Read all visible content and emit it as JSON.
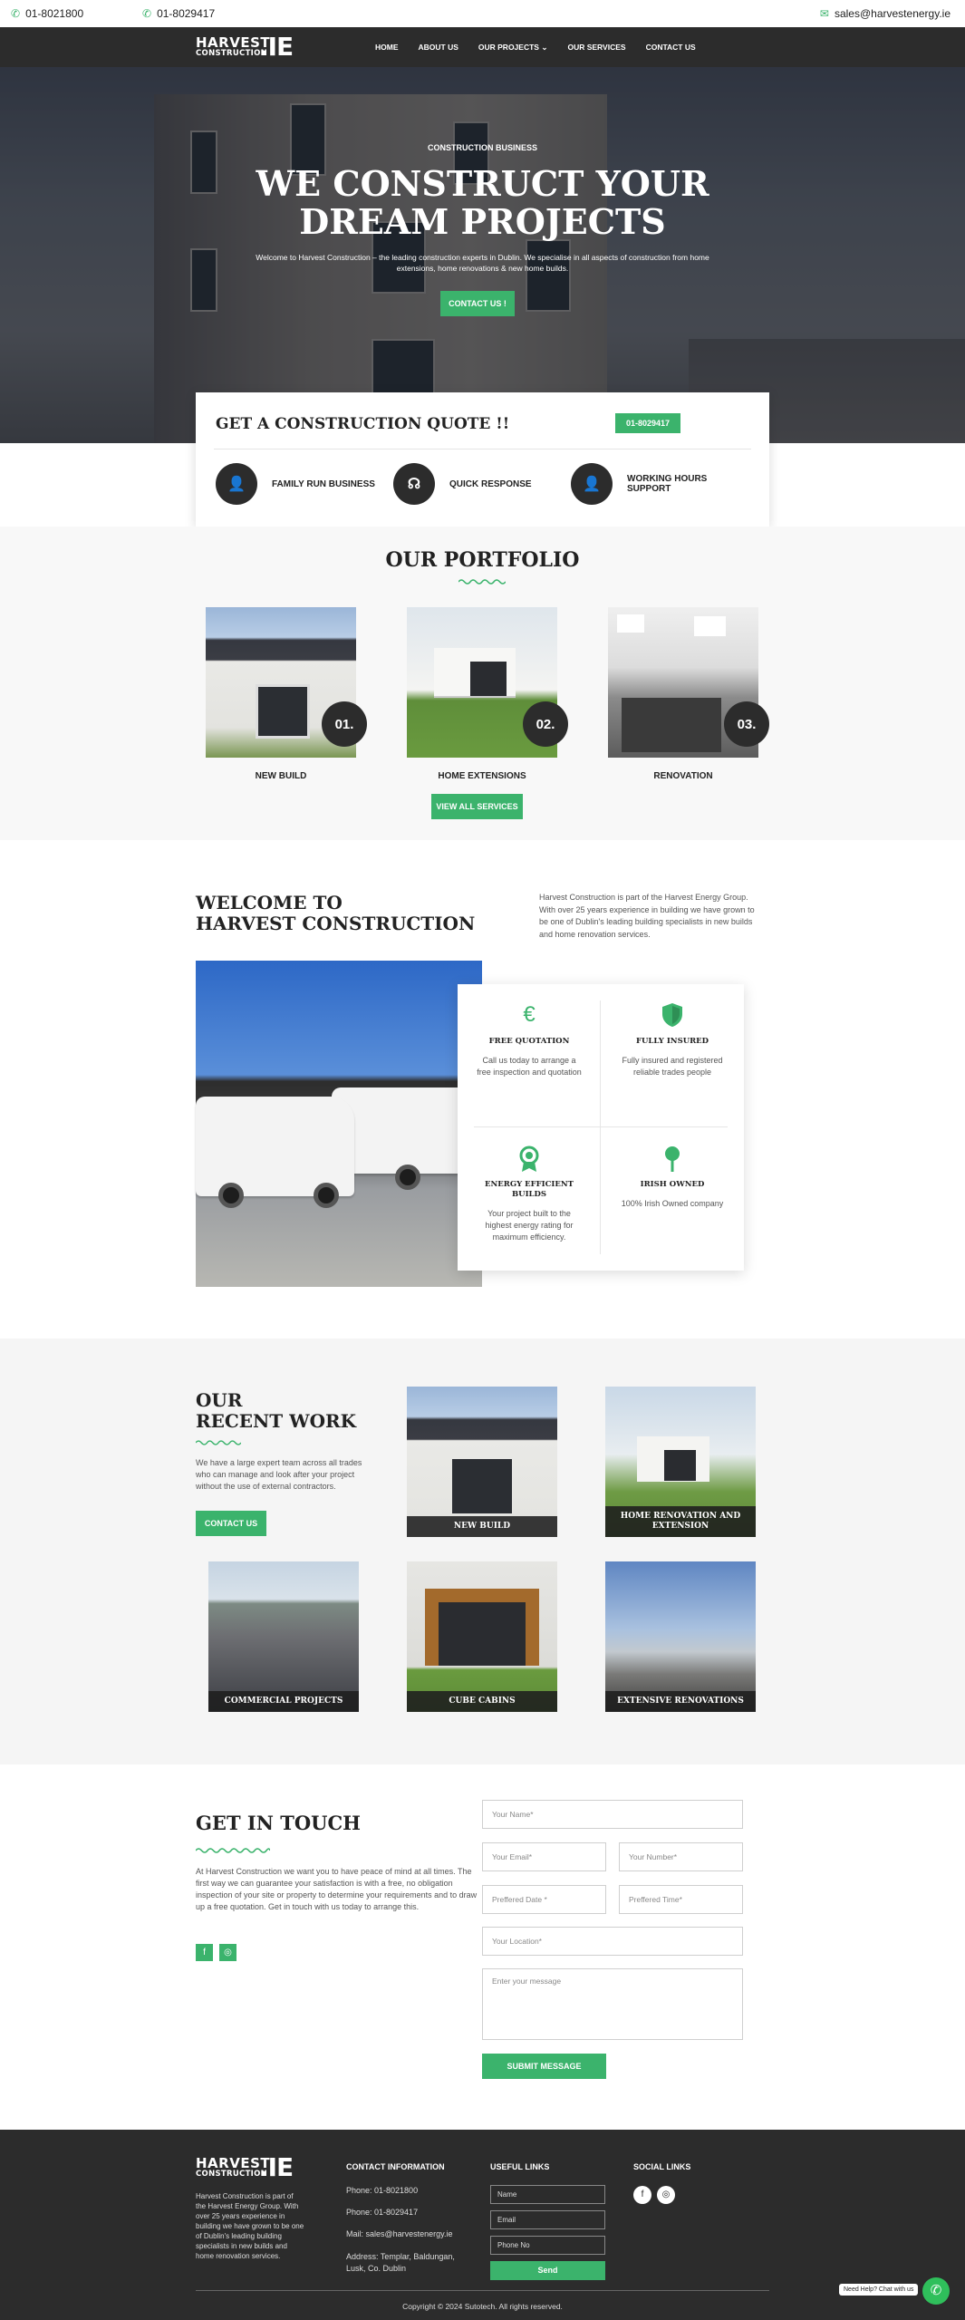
{
  "topbar": {
    "phone1": "01-8021800",
    "phone2": "01-8029417",
    "email": "sales@harvestenergy.ie"
  },
  "logo": {
    "line1": "HARVEST",
    "line2": "CONSTRUCTION",
    "suffix": ".IE"
  },
  "nav": {
    "items": [
      "HOME",
      "ABOUT US",
      "OUR PROJECTS",
      "OUR SERVICES",
      "CONTACT US"
    ]
  },
  "hero": {
    "subtitle": "CONSTRUCTION BUSINESS",
    "title_line1": "WE CONSTRUCT YOUR",
    "title_line2": "DREAM PROJECTS",
    "description": "Welcome to Harvest Construction – the leading construction experts in Dublin. We specialise in all aspects of construction from home extensions, home renovations & new home builds.",
    "cta": "CONTACT US !"
  },
  "quote": {
    "title": "GET A CONSTRUCTION QUOTE !!",
    "phone": "01-8029417",
    "features": [
      "FAMILY RUN BUSINESS",
      "QUICK RESPONSE",
      "WORKING HOURS SUPPORT"
    ]
  },
  "portfolio": {
    "title": "OUR PORTFOLIO",
    "items": [
      {
        "num": "01.",
        "label": "NEW BUILD"
      },
      {
        "num": "02.",
        "label": "HOME EXTENSIONS"
      },
      {
        "num": "03.",
        "label": "RENOVATION"
      }
    ],
    "button": "VIEW ALL SERVICES"
  },
  "welcome": {
    "title_line1": "WELCOME TO",
    "title_line2": "HARVEST CONSTRUCTION",
    "paragraph": "Harvest Construction is part of the Harvest Energy Group. With over 25 years experience in building we have grown to be one of Dublin's leading building specialists in new builds and home renovation services.",
    "features": [
      {
        "icon": "€",
        "title": "FREE QUOTATION",
        "desc": "Call us today to arrange a free inspection and quotation"
      },
      {
        "icon": "shield",
        "title": "FULLY INSURED",
        "desc": "Fully insured and registered reliable trades people"
      },
      {
        "icon": "award",
        "title": "ENERGY EFFICIENT BUILDS",
        "desc": "Your project built to the highest energy rating for maximum efficiency."
      },
      {
        "icon": "pin",
        "title": "IRISH OWNED",
        "desc": "100% Irish Owned company"
      }
    ]
  },
  "recent": {
    "title_line1": "OUR",
    "title_line2": "RECENT WORK",
    "paragraph": "We have a large expert team across all trades who can manage and look after your project without the use of external contractors.",
    "button": "CONTACT US",
    "items": [
      "NEW BUILD",
      "HOME RENOVATION AND EXTENSION",
      "COMMERCIAL PROJECTS",
      "CUBE CABINS",
      "EXTENSIVE RENOVATIONS"
    ]
  },
  "contact": {
    "title": "GET IN TOUCH",
    "paragraph": "At Harvest Construction we want you to have peace of mind at all times. The first way we can guarantee your satisfaction is with a free, no obligation inspection of your site or property to determine your requirements and to draw up a free quotation. Get in touch with us today to arrange this.",
    "placeholders": {
      "name": "Your Name*",
      "email": "Your Email*",
      "number": "Your Number*",
      "date": "Preffered Date *",
      "time": "Preffered Time*",
      "location": "Your Location*",
      "message": "Enter your message"
    },
    "submit": "SUBMIT MESSAGE"
  },
  "footer": {
    "about": "Harvest Construction is part of the Harvest Energy Group. With over 25 years experience in building we have grown to be one of Dublin's leading building specialists in new builds and home renovation services.",
    "contact_title": "CONTACT INFORMATION",
    "phone1": "Phone: 01-8021800",
    "phone2": "Phone: 01-8029417",
    "mail": "Mail: sales@harvestenergy.ie",
    "address": "Address: Templar, Baldungan, Lusk, Co. Dublin",
    "links_title": "USEFUL LINKS",
    "inputs": {
      "name": "Name",
      "email": "Email",
      "phone": "Phone No"
    },
    "send": "Send",
    "social_title": "SOCIAL LINKS",
    "copyright": "Copyright © 2024 Sutotech. All rights reserved."
  },
  "chat": {
    "label": "Need Help? Chat with us"
  },
  "colors": {
    "accent": "#3bb36c",
    "dark": "#2c2c2c"
  }
}
